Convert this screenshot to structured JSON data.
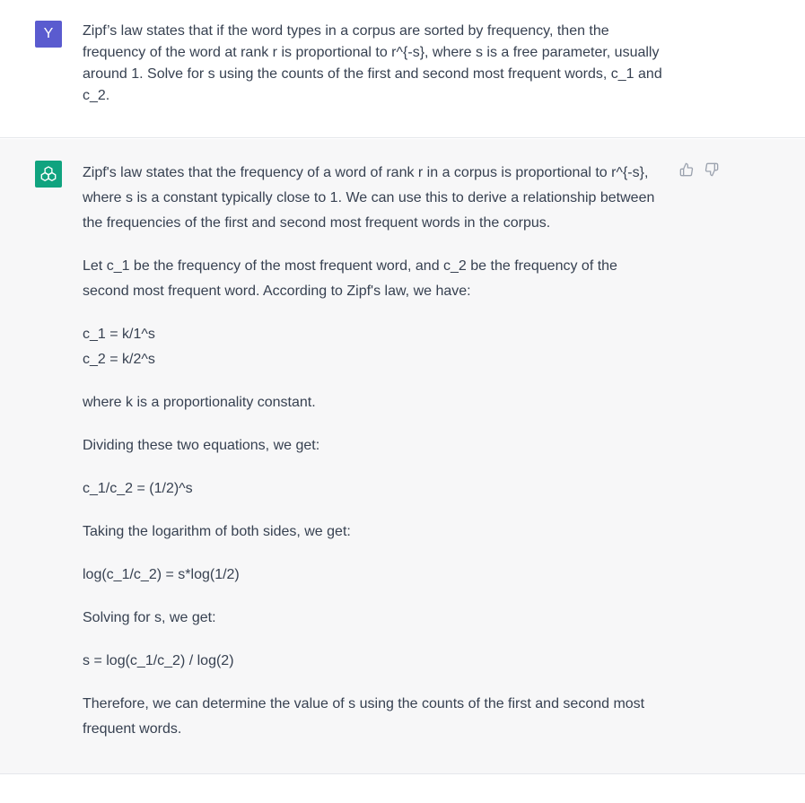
{
  "user": {
    "avatar_letter": "Y",
    "message": "Zipf’s law states that if the word types in a corpus are sorted by frequency, then the frequency of the word at rank r is proportional to r^{-s}, where s is a free parameter, usually around 1. Solve for s using the counts of the first and second most frequent words, c_1 and c_2."
  },
  "assistant": {
    "avatar_icon": "openai-logo-icon",
    "paragraphs": [
      "Zipf's law states that the frequency of a word of rank r in a corpus is proportional to r^{-s}, where s is a constant typically close to 1. We can use this to derive a relationship between the frequencies of the first and second most frequent words in the corpus.",
      "Let c_1 be the frequency of the most frequent word, and c_2 be the frequency of the second most frequent word. According to Zipf's law, we have:",
      "c_1 = k/1^s",
      "c_2 = k/2^s",
      "where k is a proportionality constant.",
      "Dividing these two equations, we get:",
      "c_1/c_2 = (1/2)^s",
      "Taking the logarithm of both sides, we get:",
      "log(c_1/c_2) = s*log(1/2)",
      "Solving for s, we get:",
      "s = log(c_1/c_2) / log(2)",
      "Therefore, we can determine the value of s using the counts of the first and second most frequent words."
    ]
  },
  "colors": {
    "user_avatar": "#5a5bcf",
    "assistant_avatar": "#10a37f",
    "assistant_bg": "#f7f7f8",
    "text": "#374151"
  }
}
